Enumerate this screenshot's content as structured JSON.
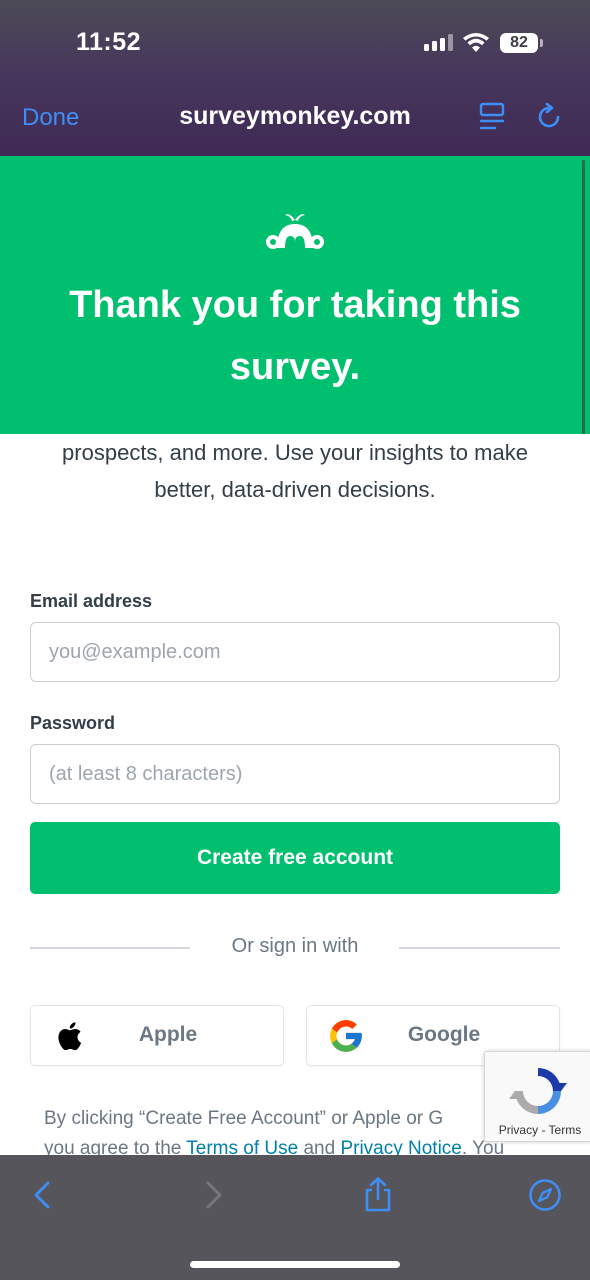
{
  "status_bar": {
    "time": "11:52",
    "battery": "82"
  },
  "browser": {
    "done_label": "Done",
    "url": "surveymonkey.com"
  },
  "banner": {
    "title": "Thank you for taking this survey."
  },
  "intro_text": "prospects, and more. Use your insights to make better, data-driven decisions.",
  "form": {
    "email_label": "Email address",
    "email_placeholder": "you@example.com",
    "email_value": "",
    "password_label": "Password",
    "password_placeholder": "(at least 8 characters)",
    "password_value": "",
    "create_button": "Create free account"
  },
  "social": {
    "or_text": "Or sign in with",
    "apple_label": "Apple",
    "google_label": "Google"
  },
  "legal": {
    "prefix": "By clicking “Create Free Account” or Apple or G",
    "line2_prefix": "you agree to the ",
    "terms_link": "Terms of Use",
    "and": " and ",
    "privacy_link": "Privacy Notice",
    "suffix": ". You"
  },
  "recaptcha": {
    "label": "Privacy - Terms"
  },
  "colors": {
    "brand_green": "#00bf6f",
    "link_blue": "#007faa",
    "ios_blue": "#3f8ef5"
  }
}
